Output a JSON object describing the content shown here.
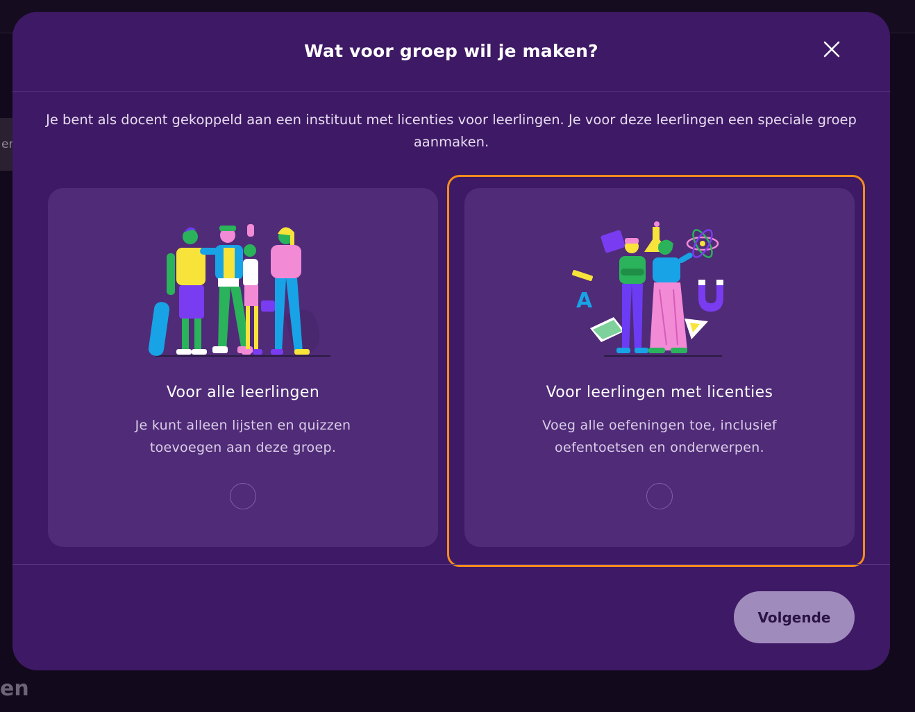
{
  "background": {
    "side_item_text": "er",
    "bottom_text": "en"
  },
  "modal": {
    "title": "Wat voor groep wil je maken?",
    "close_icon": "close-icon",
    "intro": "Je bent als docent gekoppeld aan een instituut met licenties voor leerlingen. Je voor deze leerlingen een speciale groep aanmaken.",
    "options": [
      {
        "title": "Voor alle leerlingen",
        "description": "Je kunt alleen lijsten en quizzen toevoegen aan deze groep.",
        "illustration": "group-of-students-illustration",
        "selected": false
      },
      {
        "title": "Voor leerlingen met licenties",
        "description": "Voeg alle oefeningen toe, inclusief oefentoetsen en onderwerpen.",
        "illustration": "students-with-science-objects-illustration",
        "selected": false,
        "focused": true
      }
    ],
    "next_label": "Volgende"
  },
  "colors": {
    "modal_bg": "#3e1965",
    "card_bg": "#502b78",
    "focus_outline": "#f58c1c",
    "button_bg": "#a08bbd"
  }
}
